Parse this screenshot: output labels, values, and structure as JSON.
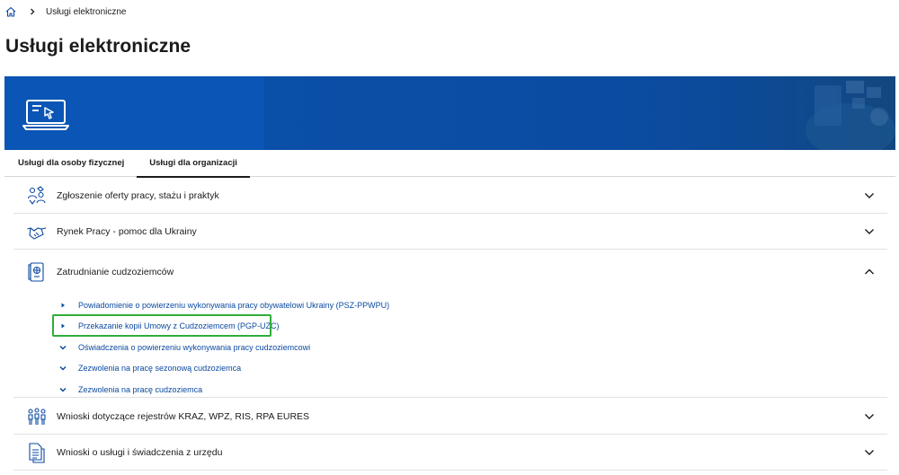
{
  "breadcrumb": {
    "home_icon": "home-icon",
    "separator_icon": "chevron-right-icon",
    "current": "Usługi elektroniczne"
  },
  "page": {
    "title": "Usługi elektroniczne"
  },
  "banner": {
    "icon": "laptop-icon",
    "colors": {
      "left": "#0a55b5",
      "right": "#0b4ca2"
    }
  },
  "tabs": [
    {
      "label": "Usługi dla osoby fizycznej",
      "active": false
    },
    {
      "label": "Usługi dla organizacji",
      "active": true
    }
  ],
  "accordion": [
    {
      "title": "Zgłoszenie oferty pracy, stażu i praktyk",
      "icon": "job-offer-icon",
      "expanded": false
    },
    {
      "title": "Rynek Pracy - pomoc dla Ukrainy",
      "icon": "handshake-icon",
      "expanded": false
    },
    {
      "title": "Zatrudnianie cudzoziemców",
      "icon": "passport-icon",
      "expanded": true,
      "items": [
        {
          "label": "Powiadomienie o powierzeniu wykonywania pracy obywatelowi Ukrainy (PSZ-PPWPU)",
          "marker": "caret-right-icon"
        },
        {
          "label": "Przekazanie kopii Umowy z Cudzoziemcem (PGP-UZC)",
          "marker": "caret-right-icon",
          "highlighted": true
        },
        {
          "label": "Oświadczenia o powierzeniu wykonywania pracy cudzoziemcowi",
          "marker": "chevron-down-icon"
        },
        {
          "label": "Zezwolenia na pracę sezonową cudzoziemca",
          "marker": "chevron-down-icon"
        },
        {
          "label": "Zezwolenia na pracę cudzoziemca",
          "marker": "chevron-down-icon"
        }
      ]
    },
    {
      "title": "Wnioski dotyczące rejestrów KRAZ, WPZ, RIS, RPA EURES",
      "icon": "people-group-icon",
      "expanded": false
    },
    {
      "title": "Wnioski o usługi i świadczenia z urzędu",
      "icon": "documents-icon",
      "expanded": false
    }
  ],
  "colors": {
    "link": "#0b4aa0",
    "highlight": "#2fae3a",
    "banner_dark": "#0b4a9e"
  }
}
